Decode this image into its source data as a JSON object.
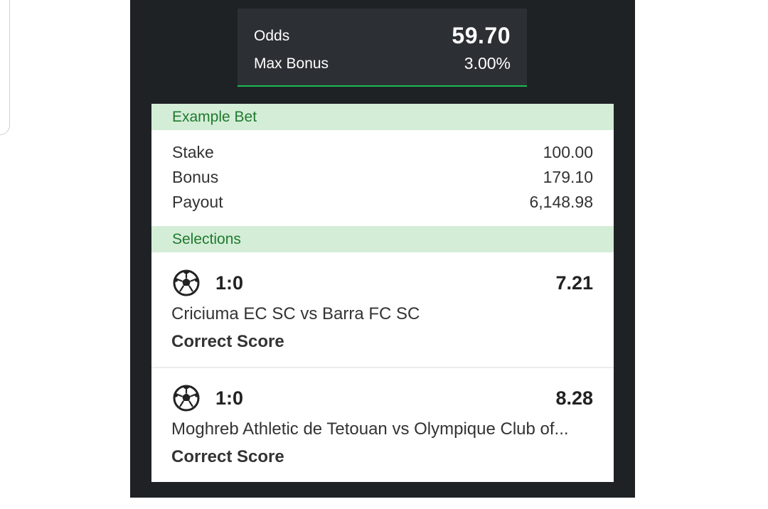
{
  "odds_summary": {
    "odds_label": "Odds",
    "odds_value": "59.70",
    "max_bonus_label": "Max Bonus",
    "max_bonus_value": "3.00%"
  },
  "example_bet": {
    "header": "Example Bet",
    "rows": [
      {
        "label": "Stake",
        "value": "100.00"
      },
      {
        "label": "Bonus",
        "value": "179.10"
      },
      {
        "label": "Payout",
        "value": "6,148.98"
      }
    ]
  },
  "selections": {
    "header": "Selections",
    "items": [
      {
        "icon": "soccer-ball-icon",
        "score": "1:0",
        "odds": "7.21",
        "match": "Criciuma EC SC vs Barra FC SC",
        "market": "Correct Score"
      },
      {
        "icon": "soccer-ball-icon",
        "score": "1:0",
        "odds": "8.28",
        "match": "Moghreb Athletic de Tetouan vs Olympique Club of...",
        "market": "Correct Score"
      }
    ]
  },
  "colors": {
    "panel_bg": "#1f2225",
    "odds_box_bg": "#2c3034",
    "accent_green": "#1db954",
    "section_header_bg": "#d4edd7",
    "section_header_text": "#1e7a2e"
  }
}
